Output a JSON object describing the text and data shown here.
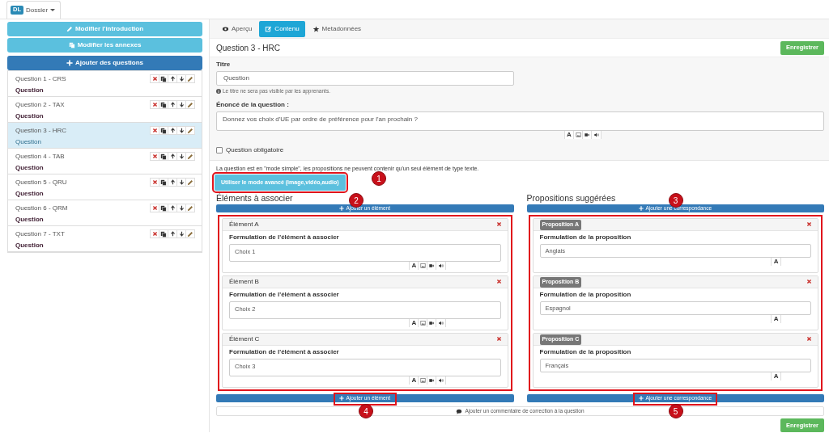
{
  "dossier_tab": {
    "badge": "DL",
    "label": "Dossier"
  },
  "sidebar": {
    "buttons": [
      {
        "label": "Modifier l'introduction",
        "kind": "info"
      },
      {
        "label": "Modifier les annexes",
        "kind": "info"
      },
      {
        "label": "Ajouter des questions",
        "kind": "primary"
      }
    ],
    "questions": [
      {
        "title": "Question 1 - CRS",
        "type": "Question",
        "selected": false
      },
      {
        "title": "Question 2 - TAX",
        "type": "Question",
        "selected": false
      },
      {
        "title": "Question 3 - HRC",
        "type": "Question",
        "selected": true
      },
      {
        "title": "Question 4 - TAB",
        "type": "Question",
        "selected": false
      },
      {
        "title": "Question 5 - QRU",
        "type": "Question",
        "selected": false
      },
      {
        "title": "Question 6 - QRM",
        "type": "Question",
        "selected": false
      },
      {
        "title": "Question 7 - TXT",
        "type": "Question",
        "selected": false
      }
    ]
  },
  "tabs": [
    {
      "label": "Aperçu",
      "selected": false
    },
    {
      "label": "Contenu",
      "selected": true
    },
    {
      "label": "Metadonnées",
      "selected": false
    }
  ],
  "question": {
    "heading": "Question 3 - HRC",
    "save": "Enregistrer",
    "title_label": "Titre",
    "title_value": "Question",
    "title_help": "Le titre ne sera pas visible par les apprenants.",
    "statement_label": "Énoncé de la question :",
    "statement_value": "Donnez vos choix d'UE par ordre de préférence pour l'an prochain ?",
    "text_tool": "A",
    "required_label": "Question obligatoire",
    "required_checked": false
  },
  "mode_notice": "La question est en \"mode simple\", les propositions ne peuvent contenir qu'un seul élément de type texte.",
  "advanced_button": {
    "label": "Utiliser le mode avancé (image,vidéo,audio)",
    "highlighted": true,
    "callout": "1"
  },
  "elements": {
    "heading": "Éléments à associer",
    "add_top": "Ajouter un élément",
    "add_bottom": "Ajouter un élément",
    "callout": "2",
    "bottom_callout": "4",
    "highlighted": true,
    "bottom_highlighted": true,
    "items": [
      {
        "name": "Élément A",
        "label": "Formulation de l'élément à associer",
        "value": "Choix 1",
        "text_tool": "A"
      },
      {
        "name": "Élément B",
        "label": "Formulation de l'élément à associer",
        "value": "Choix 2",
        "text_tool": "A"
      },
      {
        "name": "Élément C",
        "label": "Formulation de l'élément à associer",
        "value": "Choix 3",
        "text_tool": "A"
      }
    ]
  },
  "propositions": {
    "heading": "Propositions suggérées",
    "add_top": "Ajouter une correspondance",
    "add_bottom": "Ajouter une correspondance",
    "callout": "3",
    "bottom_callout": "5",
    "highlighted": true,
    "bottom_highlighted": true,
    "items": [
      {
        "name": "Proposition A",
        "label": "Formulation de la proposition",
        "value": "Anglais",
        "text_tool": "A"
      },
      {
        "name": "Proposition B",
        "label": "Formulation de la proposition",
        "value": "Espagnol",
        "text_tool": "A"
      },
      {
        "name": "Proposition C",
        "label": "Formulation de la proposition",
        "value": "Français",
        "text_tool": "A"
      }
    ]
  },
  "comment_button": "Ajouter un commentaire de correction à la question",
  "footer_save": "Enregistrer"
}
